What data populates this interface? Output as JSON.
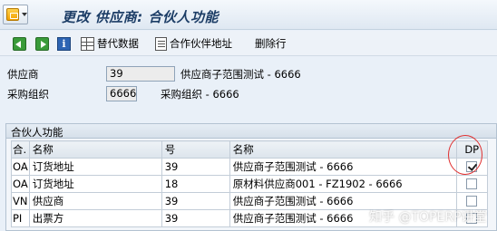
{
  "title": "更改 供应商: 合伙人功能",
  "toolbar": {
    "replace_data": "替代数据",
    "partner_address": "合作伙伴地址",
    "delete_row": "删除行"
  },
  "header": {
    "vendor_label": "供应商",
    "vendor_value": "39",
    "vendor_desc": "供应商子范围测试 - 6666",
    "purch_org_label": "采购组织",
    "purch_org_value": "6666",
    "purch_org_desc": "采购组织 - 6666"
  },
  "partner_functions": {
    "title": "合伙人功能",
    "columns": [
      "合.",
      "名称",
      "号",
      "名称",
      "DP"
    ],
    "rows": [
      {
        "code": "OA",
        "name": "订货地址",
        "number": "39",
        "partner_name": "供应商子范围测试 - 6666",
        "dp": true
      },
      {
        "code": "OA",
        "name": "订货地址",
        "number": "18",
        "partner_name": "原材料供应商001 - FZ1902 - 6666",
        "dp": false
      },
      {
        "code": "VN",
        "name": "供应商",
        "number": "39",
        "partner_name": "供应商子范围测试 - 6666",
        "dp": false
      },
      {
        "code": "PI",
        "name": "出票方",
        "number": "39",
        "partner_name": "供应商子范围测试 - 6666",
        "dp": false
      }
    ]
  },
  "watermark": "知乎 @TOPERP讲堂",
  "colors": {
    "accent_circle": "#e03030",
    "title_color": "#1c3d66"
  }
}
